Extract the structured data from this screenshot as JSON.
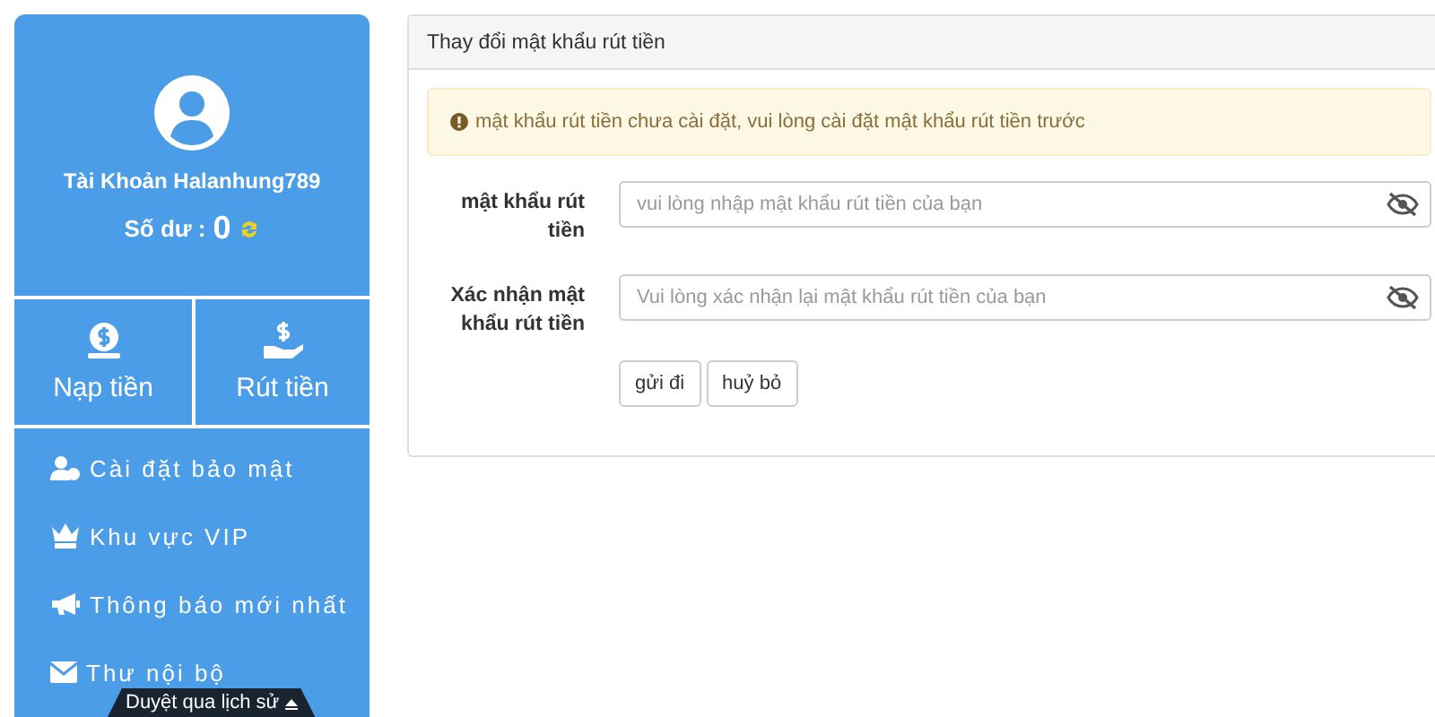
{
  "sidebar": {
    "account": "Tài Khoản Halanhung789",
    "balance_label": "Số dư :",
    "balance": "0",
    "actions": [
      {
        "kind": "deposit",
        "label": "Nạp tiền"
      },
      {
        "kind": "withdraw",
        "label": "Rút tiền"
      }
    ],
    "menu": [
      {
        "kind": "security",
        "label": "Cài đặt bảo mật"
      },
      {
        "kind": "vip",
        "label": "Khu vực VIP"
      },
      {
        "kind": "notice",
        "label": "Thông báo mới nhất"
      },
      {
        "kind": "mail",
        "label": "Thư nội bộ"
      }
    ],
    "history_tab": "Duyệt qua lịch sử"
  },
  "panel": {
    "title": "Thay đổi mật khẩu rút tiền",
    "alert": "mật khẩu rút tiền chưa cài đặt, vui lòng cài đặt mật khẩu rút tiền trước",
    "fields": [
      {
        "label": "mật khẩu rút tiền",
        "placeholder": "vui lòng nhập mật khẩu rút tiền của bạn"
      },
      {
        "label": "Xác nhận mật khẩu rút tiền",
        "placeholder": "Vui lòng xác nhận lại mật khẩu rút tiền của bạn"
      }
    ],
    "buttons": [
      "gửi đi",
      "huỷ bỏ"
    ]
  }
}
